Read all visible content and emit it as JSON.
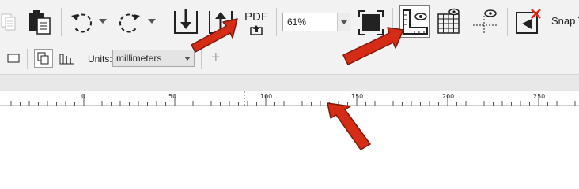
{
  "toolbar": {
    "zoom_value": "61%",
    "pdf_label": "PDF",
    "snap_label": "Snap To"
  },
  "property_bar": {
    "units_label": "Units:",
    "units_value": "millimeters",
    "add_glyph": "+"
  },
  "ruler": {
    "labels": [
      "0",
      "50",
      "100",
      "150",
      "200",
      "250"
    ]
  },
  "icons": [
    "copy-icon",
    "clipboard-icon",
    "undo-icon",
    "redo-icon",
    "import-icon",
    "export-icon",
    "pdf-icon",
    "fullscreen-icon",
    "rulers-icon",
    "grid-icon",
    "guidelines-icon",
    "snap-off-icon"
  ],
  "colors": {
    "accent": "#3aa0e0",
    "arrow": "#d62b14",
    "arrow_outline": "#7a1a0e"
  }
}
